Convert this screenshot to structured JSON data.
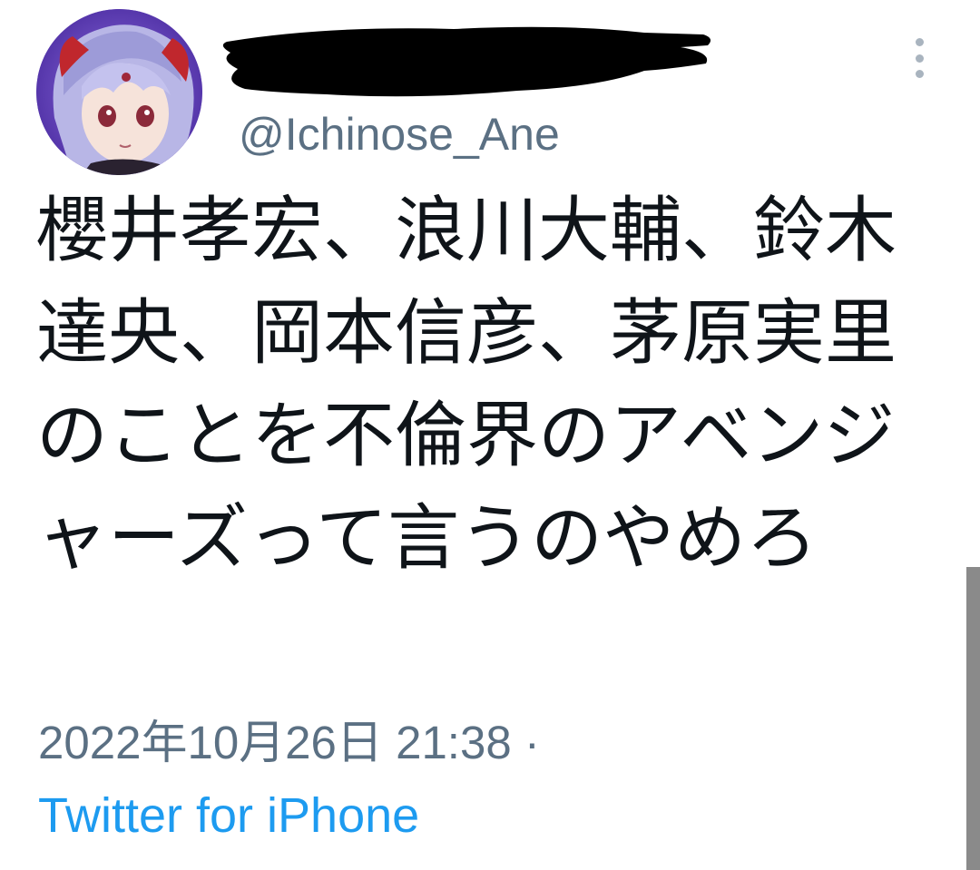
{
  "tweet": {
    "handle": "@Ichinose_Ane",
    "text": "櫻井孝宏、浪川大輔、鈴木達央、岡本信彦、茅原実里のことを不倫界のアベンジャーズって言うのやめろ",
    "timestamp": "2022年10月26日 21:38 ·",
    "source": "Twitter for iPhone"
  },
  "icons": {
    "more": "more-vertical-icon",
    "avatar": "anime-character-avatar"
  },
  "colors": {
    "text": "#0f1419",
    "secondary": "#5b7083",
    "link": "#1d9bf0",
    "redaction": "#000000"
  }
}
